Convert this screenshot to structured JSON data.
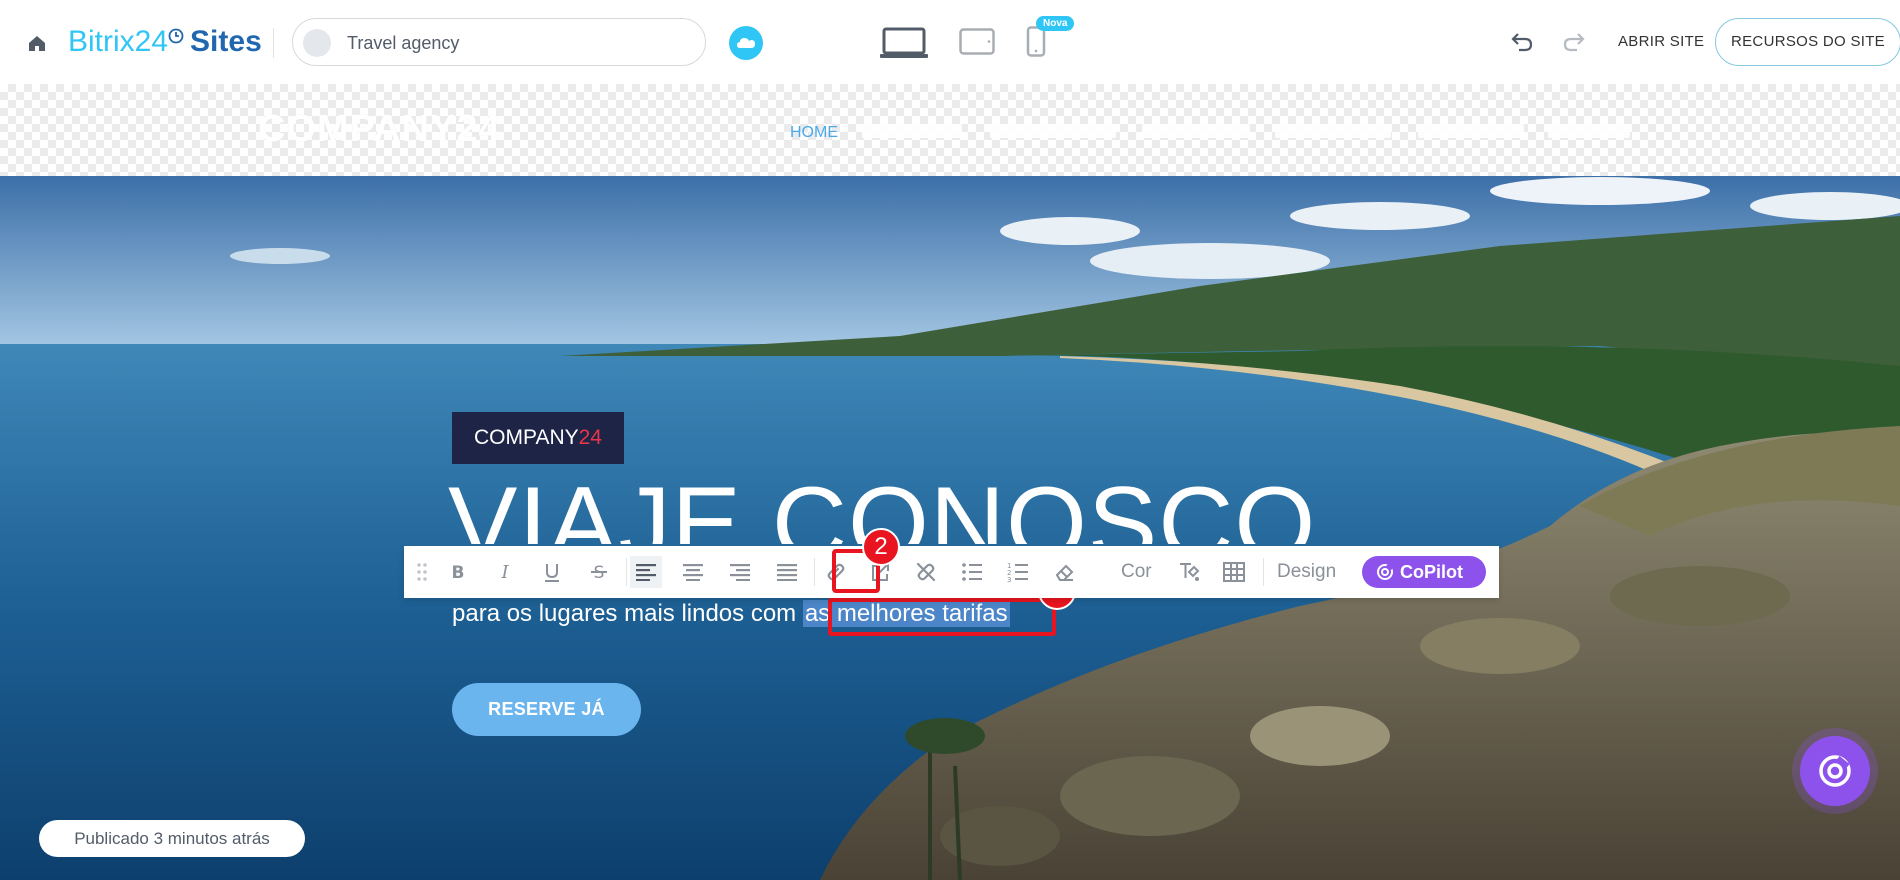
{
  "topbar": {
    "brand_part1": "Bitrix24",
    "brand_part2": "Sites",
    "site_name": "Travel agency",
    "new_badge": "Nova",
    "open_site": "ABRIR SITE",
    "site_resources": "RECURSOS DO SITE"
  },
  "site_header": {
    "logo": "COMPANY24",
    "nav_home": "HOME"
  },
  "hero": {
    "badge_company": "COMPANY",
    "badge_number": "24",
    "title": "VIAJE CONOSCO",
    "subtitle_plain": "para os lugares mais lindos com ",
    "subtitle_selected": "as melhores tarifas",
    "reserve_button": "RESERVE JÁ",
    "published_status": "Publicado 3 minutos atrás"
  },
  "toolbar": {
    "color_label": "Cor",
    "design_label": "Design",
    "copilot_label": "CoPilot",
    "icons": [
      "drag-handle-icon",
      "bold-icon",
      "italic-icon",
      "underline-icon",
      "strikethrough-icon",
      "align-left-icon",
      "align-center-icon",
      "align-right-icon",
      "align-justify-icon",
      "link-icon",
      "external-link-icon",
      "unlink-icon",
      "bullet-list-icon",
      "numbered-list-icon",
      "eraser-icon",
      "text-color-icon",
      "table-icon",
      "copilot-icon"
    ]
  },
  "annotations": {
    "step1": "1",
    "step2": "2"
  },
  "colors": {
    "accent_blue": "#2fc6f6",
    "brand_dark_blue": "#2067b0",
    "copilot_purple": "#8e52ec",
    "highlight_red": "#e8141f",
    "badge_navy": "#1e2446"
  }
}
